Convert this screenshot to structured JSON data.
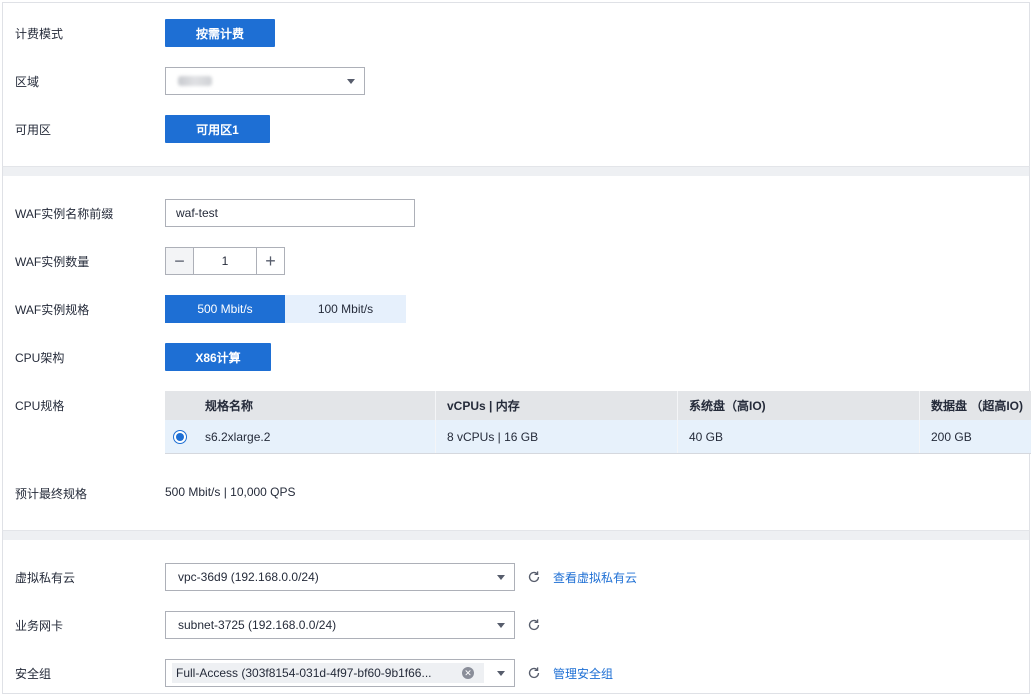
{
  "billing": {
    "label": "计费模式",
    "value": "按需计费"
  },
  "region": {
    "label": "区域"
  },
  "az": {
    "label": "可用区",
    "value": "可用区1"
  },
  "instance_prefix": {
    "label": "WAF实例名称前缀",
    "value": "waf-test"
  },
  "instance_count": {
    "label": "WAF实例数量",
    "value": "1"
  },
  "instance_spec": {
    "label": "WAF实例规格",
    "options": [
      "500 Mbit/s",
      "100 Mbit/s"
    ],
    "selected": "500 Mbit/s"
  },
  "cpu_arch": {
    "label": "CPU架构",
    "value": "X86计算"
  },
  "cpu_spec": {
    "label": "CPU规格",
    "columns": [
      "规格名称",
      "vCPUs | 内存",
      "系统盘（高IO)",
      "数据盘 （超高IO)"
    ],
    "rows": [
      {
        "name": "s6.2xlarge.2",
        "vcpu_mem": "8 vCPUs | 16 GB",
        "system_disk": "40 GB",
        "data_disk": "200 GB"
      }
    ]
  },
  "final_spec": {
    "label": "预计最终规格",
    "value": "500 Mbit/s | 10,000 QPS"
  },
  "vpc": {
    "label": "虚拟私有云",
    "value": "vpc-36d9 (192.168.0.0/24)",
    "link": "查看虚拟私有云"
  },
  "nic": {
    "label": "业务网卡",
    "value": "subnet-3725 (192.168.0.0/24)"
  },
  "security_group": {
    "label": "安全组",
    "value": "Full-Access (303f8154-031d-4f97-bf60-9b1f66...",
    "link": "管理安全组"
  },
  "colors": {
    "primary": "#1e6fd4",
    "selected_bg": "#e7f1fb",
    "header_bg": "#e3e5e8"
  }
}
